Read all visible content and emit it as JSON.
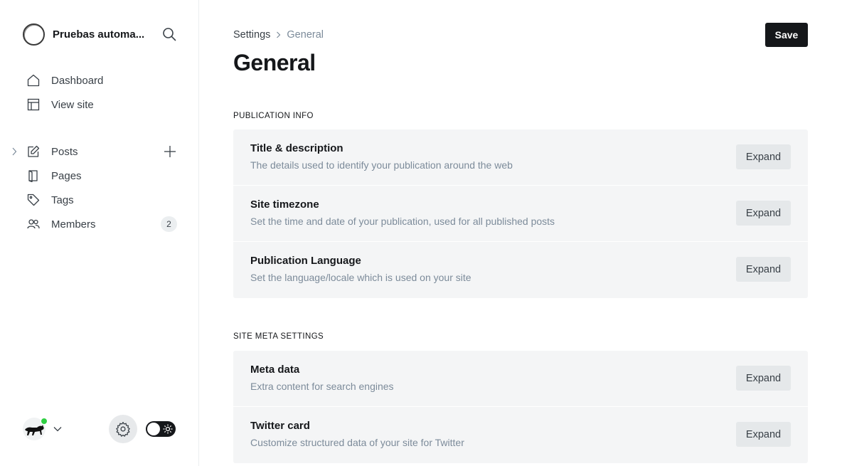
{
  "site": {
    "title": "Pruebas automa..."
  },
  "sidebar": {
    "top_items": [
      {
        "label": "Dashboard",
        "icon": "home-icon"
      },
      {
        "label": "View site",
        "icon": "layout-icon"
      }
    ],
    "content_items": [
      {
        "label": "Posts",
        "icon": "pencil-icon"
      },
      {
        "label": "Pages",
        "icon": "page-icon"
      },
      {
        "label": "Tags",
        "icon": "tag-icon"
      },
      {
        "label": "Members",
        "icon": "members-icon",
        "badge": "2"
      }
    ]
  },
  "header": {
    "breadcrumb_root": "Settings",
    "breadcrumb_current": "General",
    "save_label": "Save",
    "title": "General"
  },
  "sections": [
    {
      "label": "PUBLICATION INFO",
      "rows": [
        {
          "title": "Title & description",
          "desc": "The details used to identify your publication around the web",
          "button": "Expand"
        },
        {
          "title": "Site timezone",
          "desc": "Set the time and date of your publication, used for all published posts",
          "button": "Expand"
        },
        {
          "title": "Publication Language",
          "desc": "Set the language/locale which is used on your site",
          "button": "Expand"
        }
      ]
    },
    {
      "label": "SITE META SETTINGS",
      "rows": [
        {
          "title": "Meta data",
          "desc": "Extra content for search engines",
          "button": "Expand"
        },
        {
          "title": "Twitter card",
          "desc": "Customize structured data of your site for Twitter",
          "button": "Expand"
        }
      ]
    }
  ],
  "colors": {
    "accent": "#15171a",
    "online": "#30cf43",
    "row_bg": "#f4f5f6",
    "muted_text": "#7c8b9a"
  }
}
